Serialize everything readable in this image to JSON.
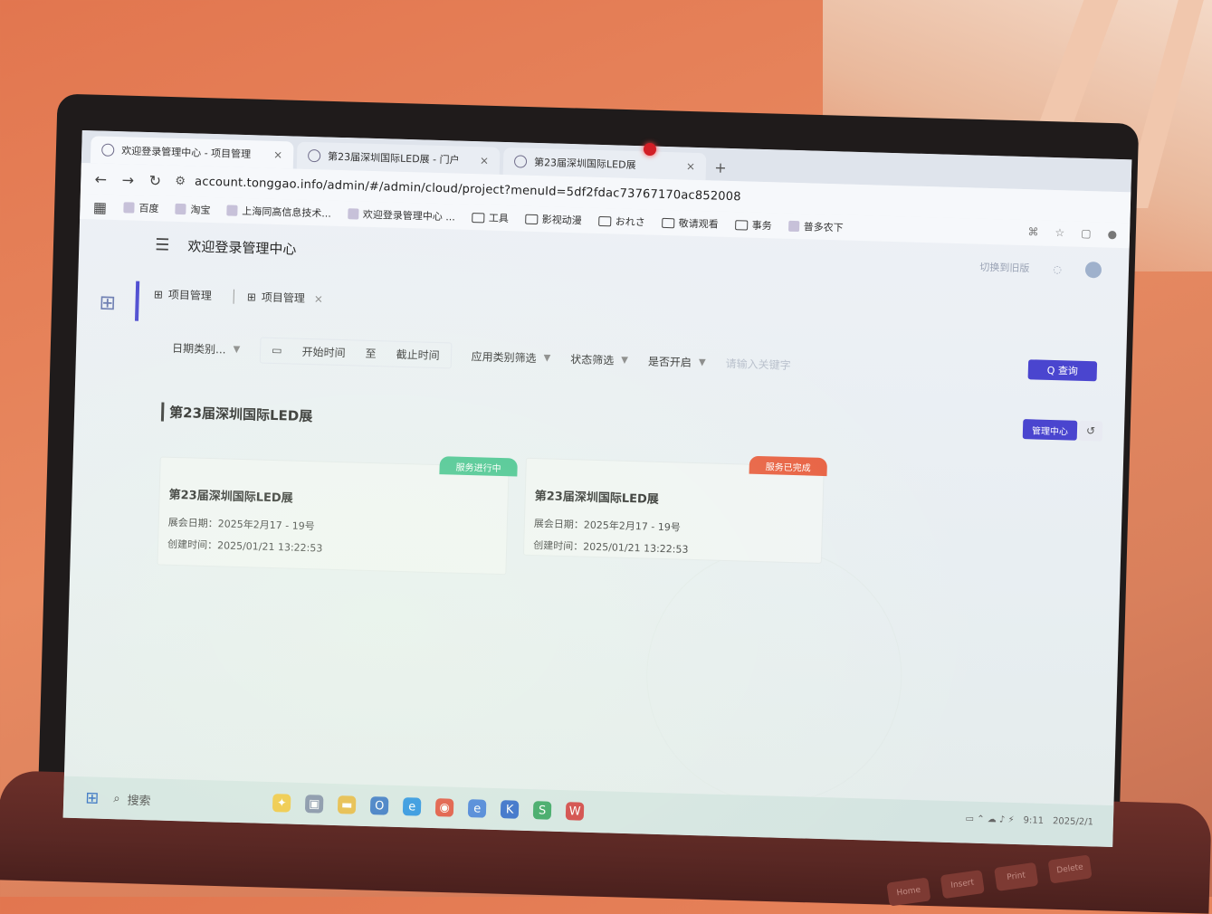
{
  "colors": {
    "accent": "#4a45cf",
    "ribbon_green": "#3bc08a",
    "ribbon_red": "#e85b3c",
    "webcam_led": "#d21e26"
  },
  "browser": {
    "tabs": [
      {
        "label": "欢迎登录管理中心 - 项目管理",
        "close": "×"
      },
      {
        "label": "第23届深圳国际LED展 - 门户",
        "close": "×"
      },
      {
        "label": "第23届深圳国际LED展",
        "close": "×"
      }
    ],
    "new_tab": "+",
    "url": "account.tonggao.info/admin/#/admin/cloud/project?menuId=5df2fdac73767170ac852008",
    "bookmarks": [
      "百度",
      "淘宝",
      "上海同高信息技术...",
      "欢迎登录管理中心 ...",
      "工具",
      "影视动漫",
      "おれさ",
      "敬请观看",
      "事务",
      "普多农下"
    ]
  },
  "app": {
    "title": "欢迎登录管理中心",
    "header_right": "切换到旧版"
  },
  "tags": [
    {
      "label": "项目管理"
    },
    {
      "label": "项目管理",
      "close": "×"
    }
  ],
  "filters": {
    "date_type": "日期类别...",
    "start": "开始时间",
    "to": "至",
    "end": "截止时间",
    "app_type": "应用类别筛选",
    "status": "状态筛选",
    "other": "是否开启",
    "search_placeholder": "请输入关键字",
    "query": "Q 查询"
  },
  "section": {
    "title": "第23届深圳国际LED展",
    "btn_center": "管理中心",
    "btn_back": "↺"
  },
  "cards": [
    {
      "ribbon": "服务进行中",
      "name": "第23届深圳国际LED展",
      "date_label": "展会日期：",
      "date_value": "2025年2月17 - 19号",
      "created_label": "创建时间：",
      "created_value": "2025/01/21 13:22:53"
    },
    {
      "ribbon": "服务已完成",
      "name": "第23届深圳国际LED展",
      "date_label": "展会日期：",
      "date_value": "2025年2月17 - 19号",
      "created_label": "创建时间：",
      "created_value": "2025/01/21 13:22:53"
    }
  ],
  "taskbar": {
    "search": "搜索",
    "time": "9:11",
    "date": "2025/2/1"
  },
  "keyboard": [
    "Delete",
    "Print",
    "Insert",
    "Home"
  ]
}
